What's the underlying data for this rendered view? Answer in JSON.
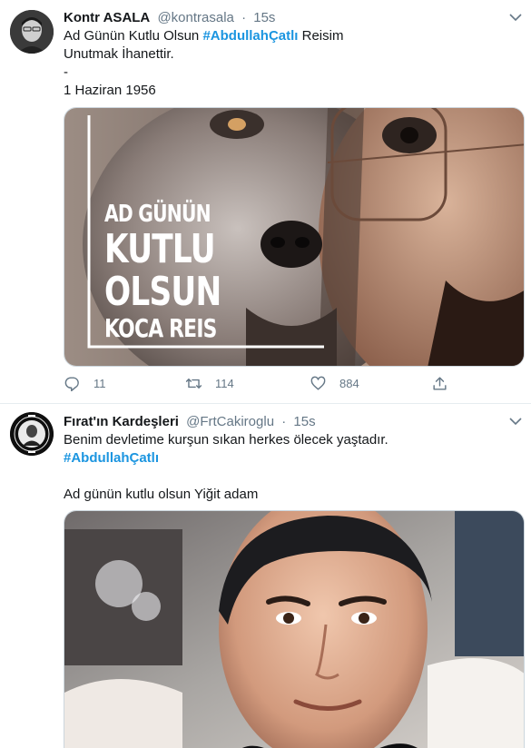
{
  "tweets": [
    {
      "author_name": "Kontr ASALA",
      "handle": "@kontrasala",
      "separator": "·",
      "time": "15s",
      "text_line1_prefix": "Ad Günün Kutlu Olsun ",
      "hashtag": "#AbdullahÇatlı",
      "text_line1_suffix": " Reisim",
      "text_line2": "Unutmak İhanettir.",
      "text_line3": "-",
      "text_line4": "1 Haziran 1956",
      "image_text": {
        "line1": "AD GÜNÜN",
        "line2": "KUTLU",
        "line3": "OLSUN",
        "line4": "KOCA REIS"
      },
      "reply_count": "11",
      "retweet_count": "114",
      "like_count": "884"
    },
    {
      "author_name": "Fırat'ın Kardeşleri",
      "handle": "@FrtCakiroglu",
      "separator": "·",
      "time": "15s",
      "text_line1": "Benim devletime kurşun sıkan herkes ölecek yaştadır.",
      "hashtag": "#AbdullahÇatlı",
      "text_line3": "Ad günün kutlu olsun Yiğit adam"
    }
  ],
  "colors": {
    "accent": "#1b95e0",
    "secondary_text": "#657786",
    "border": "#e6ecf0"
  },
  "icons": [
    "reply-icon",
    "retweet-icon",
    "like-icon",
    "share-icon",
    "chevron-down-icon"
  ]
}
